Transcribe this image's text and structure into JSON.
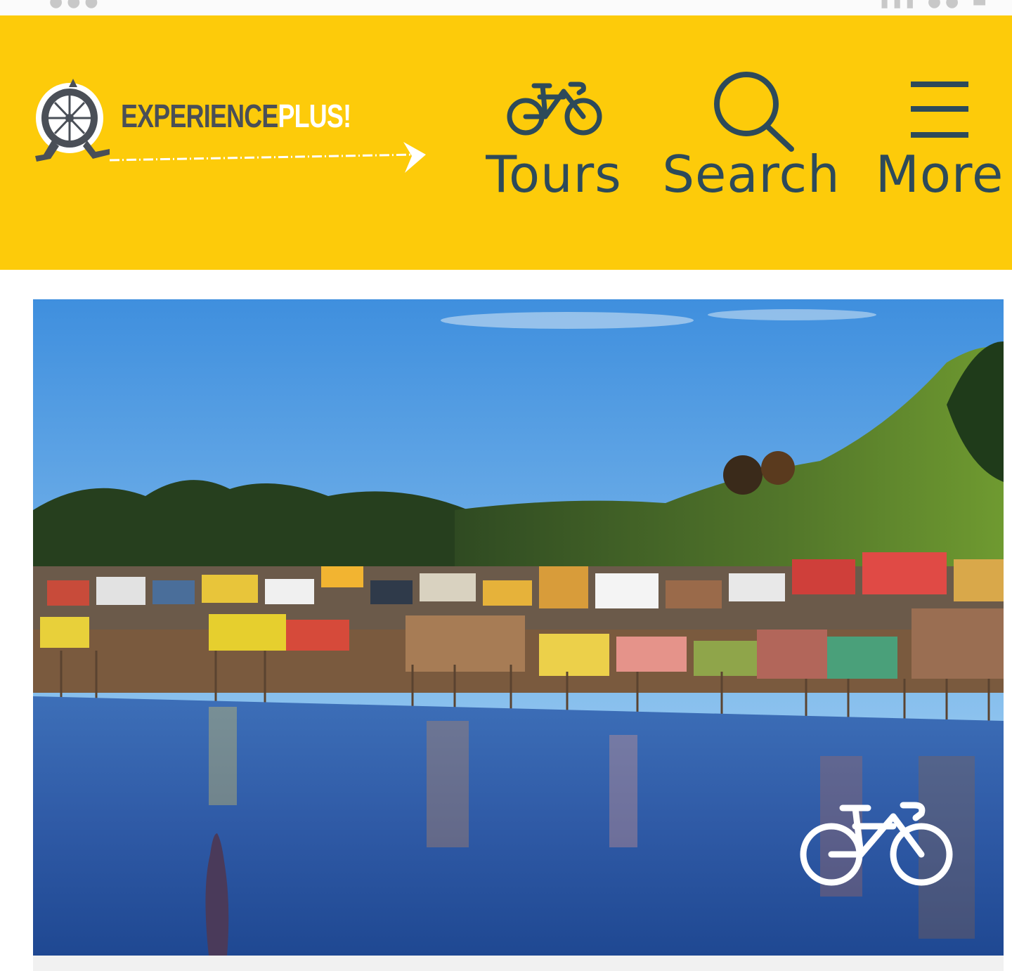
{
  "logo": {
    "brand_part1": "EXPERIENCE",
    "brand_part2": "PLUS!"
  },
  "nav": {
    "tours_label": "Tours",
    "search_label": "Search",
    "more_label": "More",
    "tours_icon": "bicycle-icon",
    "search_icon": "search-icon",
    "more_icon": "hamburger-menu-icon"
  },
  "hero": {
    "overlay_icon": "bicycle-icon"
  },
  "colors": {
    "header_bg": "#fdcb0a",
    "nav_text": "#2d4a5a",
    "logo_gray": "#4a4f57",
    "logo_white": "#ffffff"
  }
}
